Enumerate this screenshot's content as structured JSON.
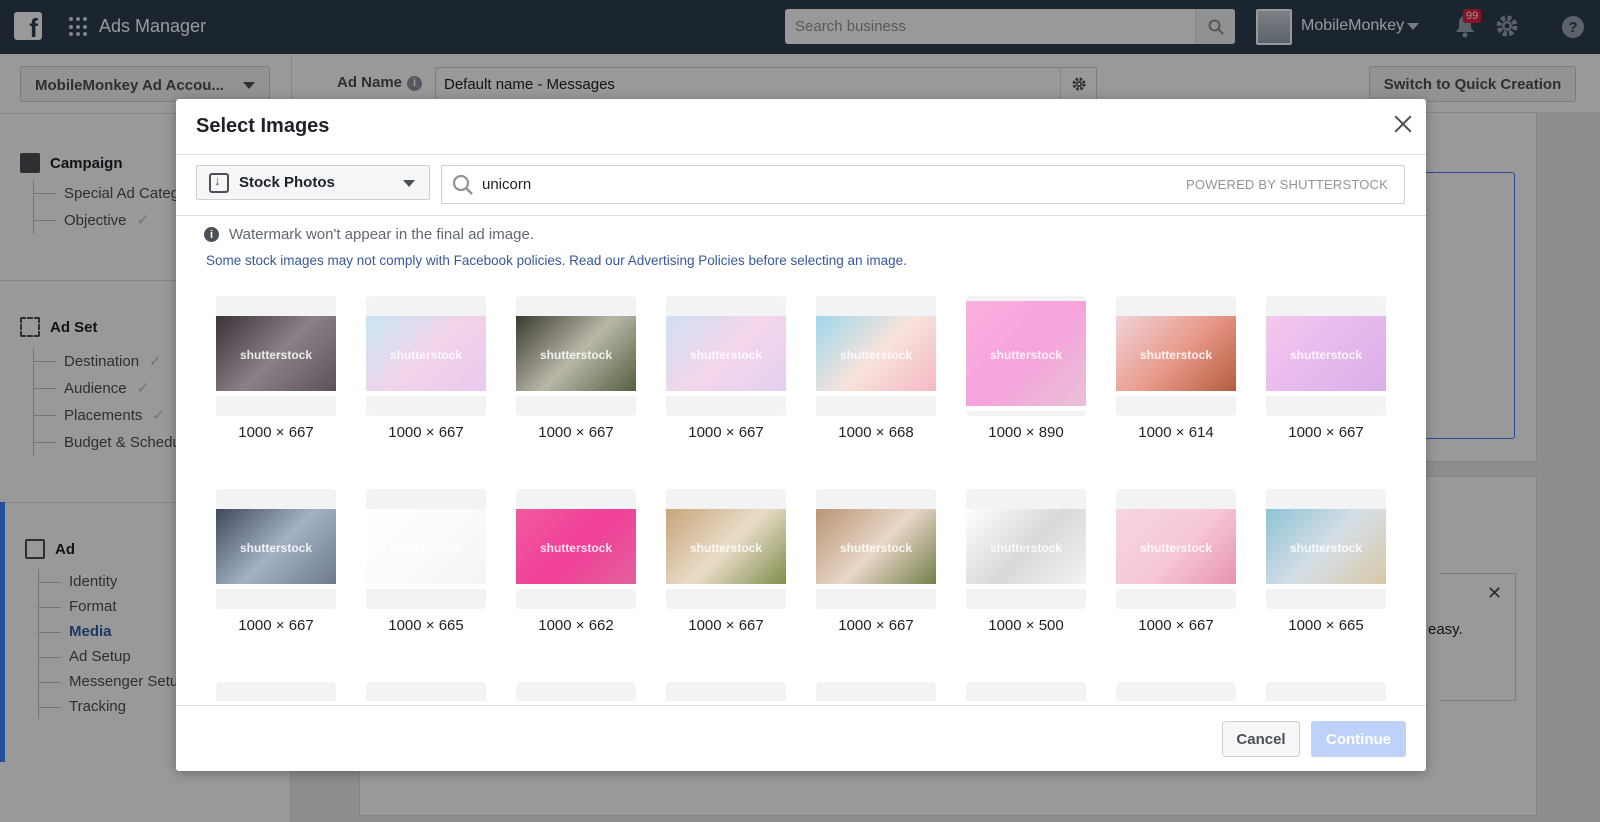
{
  "topbar": {
    "logo": "f",
    "app_title": "Ads Manager",
    "search_placeholder": "Search business",
    "account_name": "MobileMonkey",
    "notification_count": "99",
    "help": "?"
  },
  "subbar": {
    "account_select": "MobileMonkey Ad Accou...",
    "ad_name_label": "Ad Name",
    "ad_name_value": "Default name - Messages",
    "quick_creation": "Switch to Quick Creation"
  },
  "sidebar": {
    "campaign": {
      "title": "Campaign",
      "items": [
        {
          "label": "Special Ad Categ",
          "done": false
        },
        {
          "label": "Objective",
          "done": true
        }
      ]
    },
    "adset": {
      "title": "Ad Set",
      "items": [
        {
          "label": "Destination",
          "done": true
        },
        {
          "label": "Audience",
          "done": true
        },
        {
          "label": "Placements",
          "done": true
        },
        {
          "label": "Budget & Schedu",
          "done": false
        }
      ]
    },
    "ad": {
      "title": "Ad",
      "items": [
        {
          "label": "Identity"
        },
        {
          "label": "Format"
        },
        {
          "label": "Media",
          "active": true
        },
        {
          "label": "Ad Setup"
        },
        {
          "label": "Messenger Setu"
        },
        {
          "label": "Tracking"
        }
      ]
    }
  },
  "background": {
    "easy_text": "easy."
  },
  "modal": {
    "title": "Select Images",
    "source_select": "Stock Photos",
    "search_value": "unicorn",
    "powered_by": "POWERED BY SHUTTERSTOCK",
    "watermark_note": "Watermark won't appear in the final ad image.",
    "policy_note": "Some stock images may not comply with Facebook policies. Read our Advertising Policies before selecting an image.",
    "watermark_label": "shutterstock",
    "images": [
      {
        "dims": "1000 × 667",
        "colors": [
          "#3a3338",
          "#8a8088",
          "#5a4f57"
        ]
      },
      {
        "dims": "1000 × 667",
        "colors": [
          "#c7e6f4",
          "#f2d3e8",
          "#e9c9f0"
        ]
      },
      {
        "dims": "1000 × 667",
        "colors": [
          "#3b3a30",
          "#b9b7a8",
          "#4e5a3a"
        ]
      },
      {
        "dims": "1000 × 667",
        "colors": [
          "#cfe0f3",
          "#f4d6ea",
          "#e3cff3"
        ]
      },
      {
        "dims": "1000 × 668",
        "colors": [
          "#9fd7ec",
          "#f7e3dc",
          "#f6b6c2"
        ]
      },
      {
        "dims": "1000 × 890",
        "colors": [
          "#fbb0e0",
          "#f6a3dc",
          "#e8c2d7"
        ]
      },
      {
        "dims": "1000 × 614",
        "colors": [
          "#f0d3d9",
          "#e99a8a",
          "#b05a3a"
        ]
      },
      {
        "dims": "1000 × 667",
        "colors": [
          "#f5c8ec",
          "#e7b9ee",
          "#d9aee8"
        ]
      },
      {
        "dims": "1000 × 667",
        "colors": [
          "#3f4a5c",
          "#a4b1c4",
          "#6b7689"
        ]
      },
      {
        "dims": "1000 × 665",
        "colors": [
          "#ffffff",
          "#fbfbfb",
          "#f4f4f4"
        ]
      },
      {
        "dims": "1000 × 662",
        "colors": [
          "#f25aa1",
          "#f03f97",
          "#e2639f"
        ]
      },
      {
        "dims": "1000 × 667",
        "colors": [
          "#c8a57a",
          "#e9dcc9",
          "#7a8a46"
        ]
      },
      {
        "dims": "1000 × 667",
        "colors": [
          "#b99575",
          "#e9d7c8",
          "#6d7a43"
        ]
      },
      {
        "dims": "1000 × 500",
        "colors": [
          "#ffffff",
          "#d8d8d8",
          "#f4f4f4"
        ]
      },
      {
        "dims": "1000 × 667",
        "colors": [
          "#f5d5de",
          "#f7c9d6",
          "#e691ac"
        ]
      },
      {
        "dims": "1000 × 665",
        "colors": [
          "#8ec3d6",
          "#d6dfe6",
          "#d8c6a3"
        ]
      },
      {
        "dims": "",
        "colors": [
          "#3c3f2e",
          "#5b6040",
          "#2e2e25"
        ]
      },
      {
        "dims": "",
        "colors": [
          "#1f3b3b",
          "#2b5452",
          "#183030"
        ]
      },
      {
        "dims": "",
        "colors": [
          "#f2c8d2",
          "#f4d3dc",
          "#e8b9c6"
        ]
      },
      {
        "dims": "",
        "colors": [
          "#c08a4a",
          "#d6a46a",
          "#8e6531"
        ]
      },
      {
        "dims": "",
        "colors": [
          "#e8d8f0",
          "#efe4f5",
          "#dcc9e8"
        ]
      },
      {
        "dims": "",
        "colors": [
          "#5a4a2e",
          "#3e3320",
          "#7a6441"
        ]
      },
      {
        "dims": "",
        "colors": [
          "#f7e3e6",
          "#f2c9d0",
          "#eeb3be"
        ]
      },
      {
        "dims": "",
        "colors": [
          "#cfdbe3",
          "#a9bac6",
          "#dfe7ec"
        ]
      }
    ],
    "cancel": "Cancel",
    "continue": "Continue"
  },
  "colors": {
    "topbar": "#2d3e50",
    "accent": "#4080ff",
    "link": "#385898",
    "continue_disabled": "#bed2f9"
  }
}
